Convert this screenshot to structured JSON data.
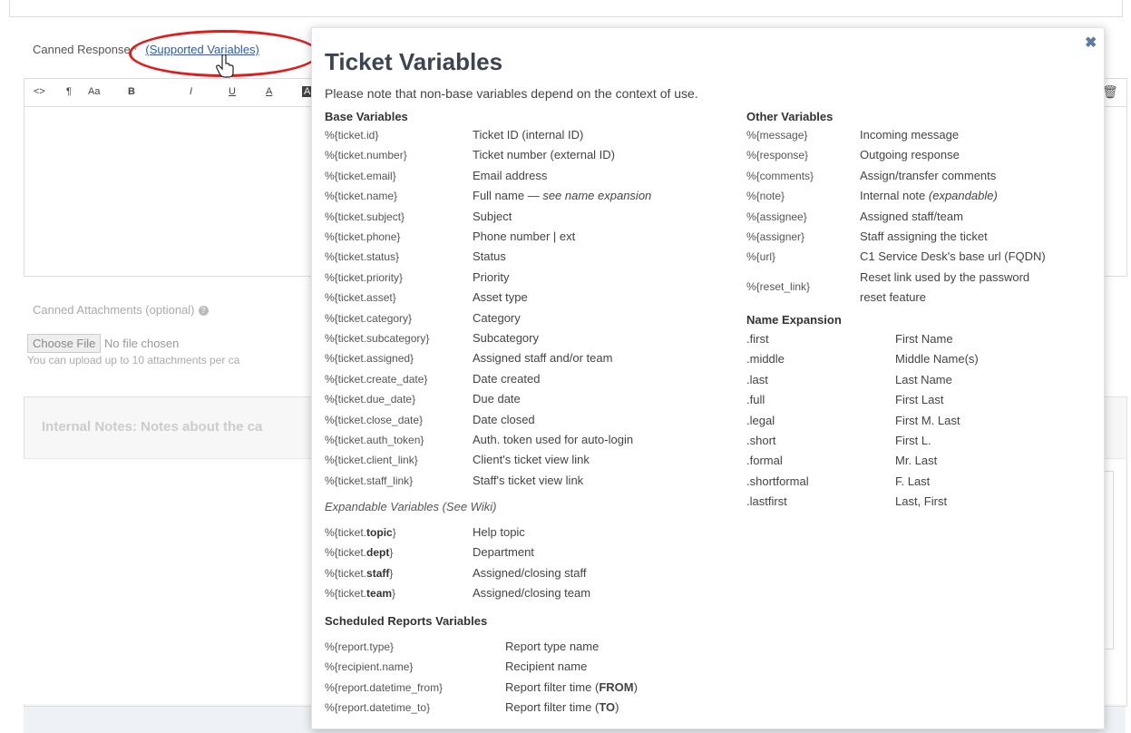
{
  "page": {
    "canned_response_label": "Canned Response",
    "required_mark": "*",
    "supported_variables_link": "(Supported Variables)",
    "canned_attachments_label": "Canned Attachments (optional)",
    "choose_file_button": "Choose File",
    "no_file_text": "No file chosen",
    "upload_note": "You can upload up to 10 attachments per ca",
    "internal_notes_title": "Internal Notes: Notes about the ca"
  },
  "toolbar": {
    "items": [
      "<>",
      "¶",
      "Aa",
      "B",
      "I",
      "U",
      "A",
      "A"
    ]
  },
  "popup": {
    "title": "Ticket Variables",
    "note": "Please note that non-base variables depend on the context of use.",
    "close_icon": "close-icon",
    "base": {
      "heading": "Base Variables",
      "rows": [
        {
          "var": "%{ticket.id}",
          "desc": "Ticket ID (internal ID)"
        },
        {
          "var": "%{ticket.number}",
          "desc": "Ticket number (external ID)"
        },
        {
          "var": "%{ticket.email}",
          "desc": "Email address"
        },
        {
          "var": "%{ticket.name}",
          "desc": "Full name — ",
          "desc_em": "see name expansion"
        },
        {
          "var": "%{ticket.subject}",
          "desc": "Subject"
        },
        {
          "var": "%{ticket.phone}",
          "desc": "Phone number | ext"
        },
        {
          "var": "%{ticket.status}",
          "desc": "Status"
        },
        {
          "var": "%{ticket.priority}",
          "desc": "Priority"
        },
        {
          "var": "%{ticket.asset}",
          "desc": "Asset type"
        },
        {
          "var": "%{ticket.category}",
          "desc": "Category"
        },
        {
          "var": "%{ticket.subcategory}",
          "desc": "Subcategory"
        },
        {
          "var": "%{ticket.assigned}",
          "desc": "Assigned staff and/or team"
        },
        {
          "var": "%{ticket.create_date}",
          "desc": "Date created"
        },
        {
          "var": "%{ticket.due_date}",
          "desc": "Due date"
        },
        {
          "var": "%{ticket.close_date}",
          "desc": "Date closed"
        },
        {
          "var": "%{ticket.auth_token}",
          "desc": "Auth. token used for auto-login"
        },
        {
          "var": "%{ticket.client_link}",
          "desc": "Client's ticket view link"
        },
        {
          "var": "%{ticket.staff_link}",
          "desc": "Staff's ticket view link"
        }
      ]
    },
    "expandable": {
      "heading": "Expandable Variables (See Wiki)",
      "rows": [
        {
          "var_prefix": "%{ticket.",
          "var_bold": "topic",
          "var_suffix": "}",
          "desc": "Help topic"
        },
        {
          "var_prefix": "%{ticket.",
          "var_bold": "dept",
          "var_suffix": "}",
          "desc": "Department"
        },
        {
          "var_prefix": "%{ticket.",
          "var_bold": "staff",
          "var_suffix": "}",
          "desc": "Assigned/closing staff"
        },
        {
          "var_prefix": "%{ticket.",
          "var_bold": "team",
          "var_suffix": "}",
          "desc": "Assigned/closing team"
        }
      ]
    },
    "scheduled": {
      "heading": "Scheduled Reports Variables",
      "rows": [
        {
          "var": "%{report.type}",
          "desc": "Report type name",
          "desc_bold": "",
          "desc_end": ""
        },
        {
          "var": "%{recipient.name}",
          "desc": "Recipient name",
          "desc_bold": "",
          "desc_end": ""
        },
        {
          "var": "%{report.datetime_from}",
          "desc": "Report filter time (",
          "desc_bold": "FROM",
          "desc_end": ")"
        },
        {
          "var": "%{report.datetime_to}",
          "desc": "Report filter time (",
          "desc_bold": "TO",
          "desc_end": ")"
        }
      ]
    },
    "other": {
      "heading": "Other Variables",
      "rows": [
        {
          "var": "%{message}",
          "desc": "Incoming message"
        },
        {
          "var": "%{response}",
          "desc": "Outgoing response"
        },
        {
          "var": "%{comments}",
          "desc": "Assign/transfer comments"
        },
        {
          "var": "%{note}",
          "desc": "Internal note ",
          "desc_em": "(expandable)"
        },
        {
          "var": "%{assignee}",
          "desc": "Assigned staff/team"
        },
        {
          "var": "%{assigner}",
          "desc": "Staff assigning the ticket"
        },
        {
          "var": "%{url}",
          "desc": "C1 Service Desk's base url (FQDN)"
        }
      ],
      "reset_var": "%{reset_link}",
      "reset_desc_line1": "Reset link used by the password",
      "reset_desc_line2": "reset feature"
    },
    "name_expansion": {
      "heading": "Name Expansion",
      "rows": [
        {
          "key": ".first",
          "value": "First Name"
        },
        {
          "key": ".middle",
          "value": "Middle Name(s)"
        },
        {
          "key": ".last",
          "value": "Last Name"
        },
        {
          "key": ".full",
          "value": "First Last"
        },
        {
          "key": ".legal",
          "value": "First M. Last"
        },
        {
          "key": ".short",
          "value": "First L."
        },
        {
          "key": ".formal",
          "value": "Mr. Last"
        },
        {
          "key": ".shortformal",
          "value": "F. Last"
        },
        {
          "key": ".lastfirst",
          "value": "Last, First"
        }
      ]
    }
  },
  "colors": {
    "highlight_ellipse": "#e01d1d",
    "link": "#2a5db0",
    "title": "#3d4451"
  }
}
